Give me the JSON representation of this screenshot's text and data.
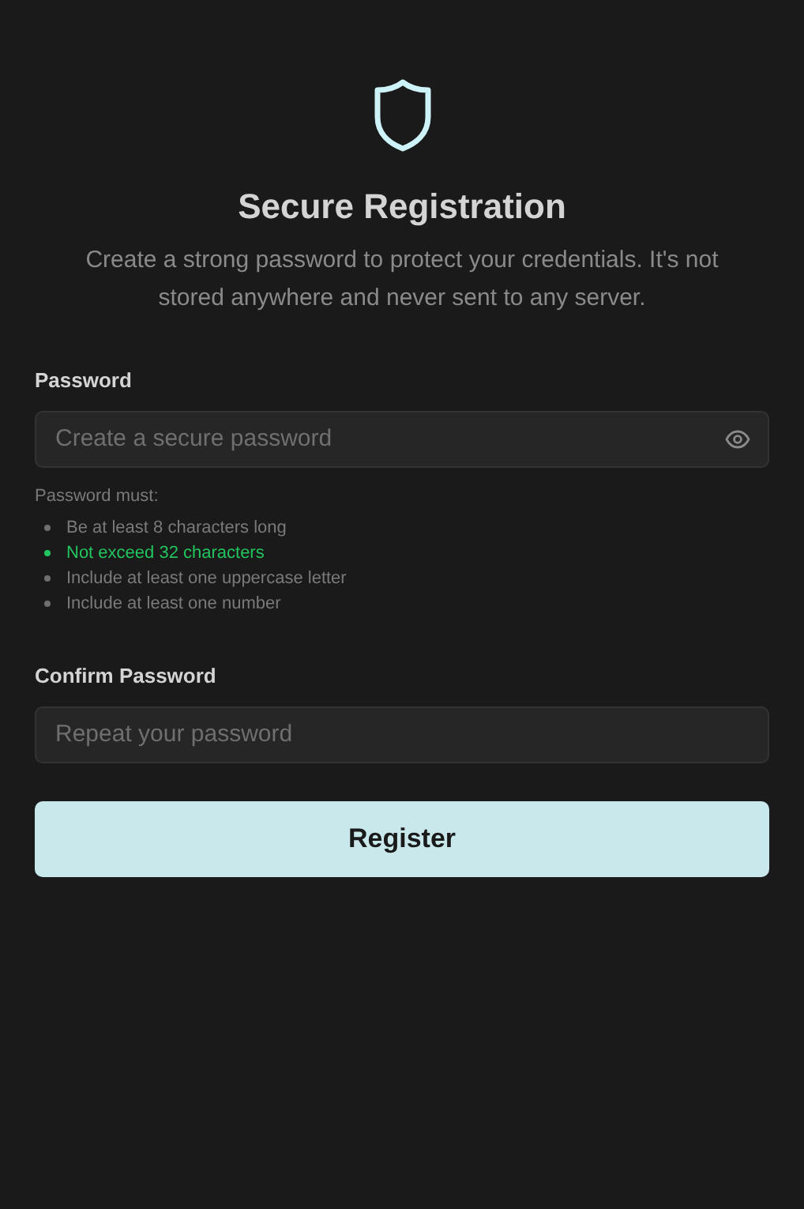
{
  "header": {
    "title": "Secure Registration",
    "subtitle": "Create a strong password to protect your credentials. It's not stored anywhere and never sent to any server."
  },
  "password": {
    "label": "Password",
    "placeholder": "Create a secure password"
  },
  "requirements": {
    "heading": "Password must:",
    "items": [
      {
        "text": "Be at least 8 characters long",
        "met": false
      },
      {
        "text": "Not exceed 32 characters",
        "met": true
      },
      {
        "text": "Include at least one uppercase letter",
        "met": false
      },
      {
        "text": "Include at least one number",
        "met": false
      }
    ]
  },
  "confirm": {
    "label": "Confirm Password",
    "placeholder": "Repeat your password"
  },
  "button": "Register"
}
